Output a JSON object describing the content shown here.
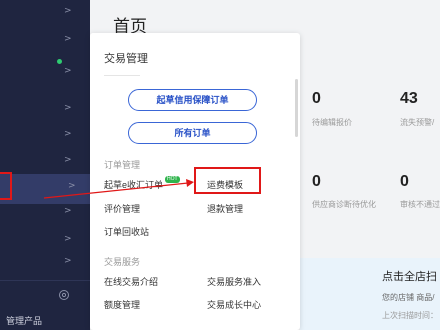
{
  "sidebar": {
    "bottom_label": "管理产品",
    "chevron": ">"
  },
  "page": {
    "title": "首页"
  },
  "stats": [
    {
      "value": "0",
      "label": "待编辑报价"
    },
    {
      "value": "43",
      "label": "流失预警/"
    },
    {
      "value": "0",
      "label": "供应商诊断待优化"
    },
    {
      "value": "0",
      "label": "审核不通过"
    }
  ],
  "promo": {
    "title": "点击全店扫",
    "line1": "您的店铺 商品/",
    "line2": "上次扫描时间："
  },
  "panel": {
    "title": "交易管理",
    "buttons": [
      "起草信用保障订单",
      "所有订单"
    ],
    "section_order": "订单管理",
    "order_links": [
      "起草e收汇订单",
      "运费模板",
      "评价管理",
      "退款管理",
      "订单回收站"
    ],
    "hot_badge": "HOT",
    "section_service": "交易服务",
    "service_links": [
      "在线交易介绍",
      "交易服务准入",
      "额度管理",
      "交易成长中心"
    ]
  },
  "colors": {
    "sidebar": "#1f2540",
    "accent": "#2851c7",
    "highlight": "#e01818"
  }
}
